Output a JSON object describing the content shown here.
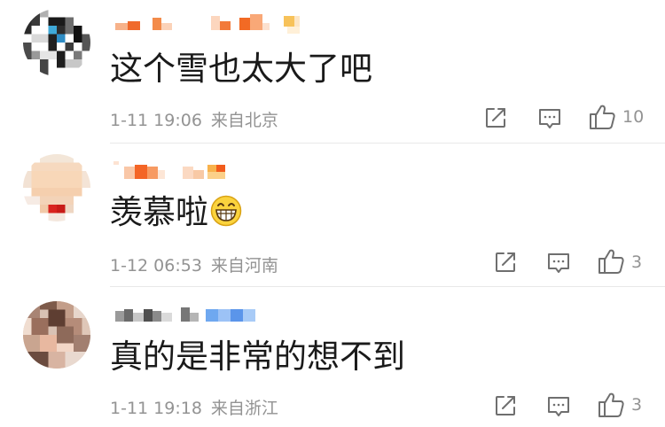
{
  "comments": [
    {
      "avatar_icon": "user-avatar-pixelated",
      "username_icon": "username-blurred",
      "text": "这个雪也太大了吧",
      "date": "1-11 19:06",
      "location": "来自北京",
      "like_count": "10"
    },
    {
      "avatar_icon": "user-avatar-pixelated",
      "username_icon": "username-blurred",
      "text": "羡慕啦",
      "emoji": "grinning-face-emoji",
      "date": "1-12 06:53",
      "location": "来自河南",
      "like_count": "3"
    },
    {
      "avatar_icon": "user-avatar-pixelated",
      "username_icon": "username-blurred",
      "text": "真的是非常的想不到",
      "date": "1-11 19:18",
      "location": "来自浙江",
      "like_count": "3"
    }
  ],
  "icons": {
    "share": "share-icon",
    "comment": "comment-icon",
    "like": "thumbs-up-icon"
  },
  "colors": {
    "text": "#1a1a1a",
    "meta": "#939393",
    "divider": "#e8e8e8"
  }
}
